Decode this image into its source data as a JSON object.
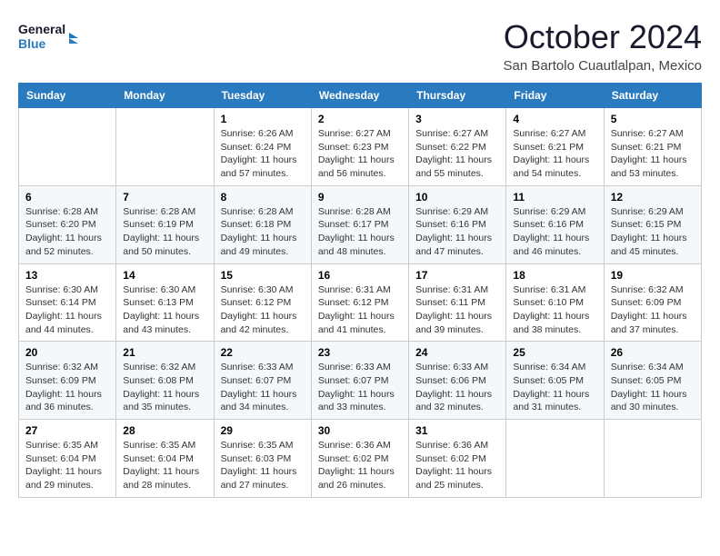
{
  "header": {
    "logo_line1": "General",
    "logo_line2": "Blue",
    "month": "October 2024",
    "location": "San Bartolo Cuautlalpan, Mexico"
  },
  "days_of_week": [
    "Sunday",
    "Monday",
    "Tuesday",
    "Wednesday",
    "Thursday",
    "Friday",
    "Saturday"
  ],
  "weeks": [
    [
      {
        "day": "",
        "info": ""
      },
      {
        "day": "",
        "info": ""
      },
      {
        "day": "1",
        "info": "Sunrise: 6:26 AM\nSunset: 6:24 PM\nDaylight: 11 hours and 57 minutes."
      },
      {
        "day": "2",
        "info": "Sunrise: 6:27 AM\nSunset: 6:23 PM\nDaylight: 11 hours and 56 minutes."
      },
      {
        "day": "3",
        "info": "Sunrise: 6:27 AM\nSunset: 6:22 PM\nDaylight: 11 hours and 55 minutes."
      },
      {
        "day": "4",
        "info": "Sunrise: 6:27 AM\nSunset: 6:21 PM\nDaylight: 11 hours and 54 minutes."
      },
      {
        "day": "5",
        "info": "Sunrise: 6:27 AM\nSunset: 6:21 PM\nDaylight: 11 hours and 53 minutes."
      }
    ],
    [
      {
        "day": "6",
        "info": "Sunrise: 6:28 AM\nSunset: 6:20 PM\nDaylight: 11 hours and 52 minutes."
      },
      {
        "day": "7",
        "info": "Sunrise: 6:28 AM\nSunset: 6:19 PM\nDaylight: 11 hours and 50 minutes."
      },
      {
        "day": "8",
        "info": "Sunrise: 6:28 AM\nSunset: 6:18 PM\nDaylight: 11 hours and 49 minutes."
      },
      {
        "day": "9",
        "info": "Sunrise: 6:28 AM\nSunset: 6:17 PM\nDaylight: 11 hours and 48 minutes."
      },
      {
        "day": "10",
        "info": "Sunrise: 6:29 AM\nSunset: 6:16 PM\nDaylight: 11 hours and 47 minutes."
      },
      {
        "day": "11",
        "info": "Sunrise: 6:29 AM\nSunset: 6:16 PM\nDaylight: 11 hours and 46 minutes."
      },
      {
        "day": "12",
        "info": "Sunrise: 6:29 AM\nSunset: 6:15 PM\nDaylight: 11 hours and 45 minutes."
      }
    ],
    [
      {
        "day": "13",
        "info": "Sunrise: 6:30 AM\nSunset: 6:14 PM\nDaylight: 11 hours and 44 minutes."
      },
      {
        "day": "14",
        "info": "Sunrise: 6:30 AM\nSunset: 6:13 PM\nDaylight: 11 hours and 43 minutes."
      },
      {
        "day": "15",
        "info": "Sunrise: 6:30 AM\nSunset: 6:12 PM\nDaylight: 11 hours and 42 minutes."
      },
      {
        "day": "16",
        "info": "Sunrise: 6:31 AM\nSunset: 6:12 PM\nDaylight: 11 hours and 41 minutes."
      },
      {
        "day": "17",
        "info": "Sunrise: 6:31 AM\nSunset: 6:11 PM\nDaylight: 11 hours and 39 minutes."
      },
      {
        "day": "18",
        "info": "Sunrise: 6:31 AM\nSunset: 6:10 PM\nDaylight: 11 hours and 38 minutes."
      },
      {
        "day": "19",
        "info": "Sunrise: 6:32 AM\nSunset: 6:09 PM\nDaylight: 11 hours and 37 minutes."
      }
    ],
    [
      {
        "day": "20",
        "info": "Sunrise: 6:32 AM\nSunset: 6:09 PM\nDaylight: 11 hours and 36 minutes."
      },
      {
        "day": "21",
        "info": "Sunrise: 6:32 AM\nSunset: 6:08 PM\nDaylight: 11 hours and 35 minutes."
      },
      {
        "day": "22",
        "info": "Sunrise: 6:33 AM\nSunset: 6:07 PM\nDaylight: 11 hours and 34 minutes."
      },
      {
        "day": "23",
        "info": "Sunrise: 6:33 AM\nSunset: 6:07 PM\nDaylight: 11 hours and 33 minutes."
      },
      {
        "day": "24",
        "info": "Sunrise: 6:33 AM\nSunset: 6:06 PM\nDaylight: 11 hours and 32 minutes."
      },
      {
        "day": "25",
        "info": "Sunrise: 6:34 AM\nSunset: 6:05 PM\nDaylight: 11 hours and 31 minutes."
      },
      {
        "day": "26",
        "info": "Sunrise: 6:34 AM\nSunset: 6:05 PM\nDaylight: 11 hours and 30 minutes."
      }
    ],
    [
      {
        "day": "27",
        "info": "Sunrise: 6:35 AM\nSunset: 6:04 PM\nDaylight: 11 hours and 29 minutes."
      },
      {
        "day": "28",
        "info": "Sunrise: 6:35 AM\nSunset: 6:04 PM\nDaylight: 11 hours and 28 minutes."
      },
      {
        "day": "29",
        "info": "Sunrise: 6:35 AM\nSunset: 6:03 PM\nDaylight: 11 hours and 27 minutes."
      },
      {
        "day": "30",
        "info": "Sunrise: 6:36 AM\nSunset: 6:02 PM\nDaylight: 11 hours and 26 minutes."
      },
      {
        "day": "31",
        "info": "Sunrise: 6:36 AM\nSunset: 6:02 PM\nDaylight: 11 hours and 25 minutes."
      },
      {
        "day": "",
        "info": ""
      },
      {
        "day": "",
        "info": ""
      }
    ]
  ]
}
